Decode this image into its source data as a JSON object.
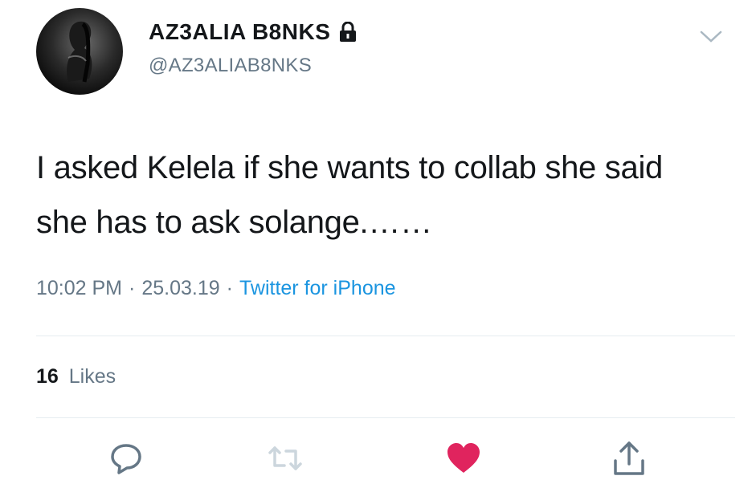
{
  "user": {
    "display_name": "AZ3ALIA B8NKS",
    "handle": "@AZ3ALIAB8NKS"
  },
  "tweet": {
    "text_line1": "I asked Kelela if she wants to collab she said",
    "text_line2": "she has to ask solange.……",
    "time": "10:02 PM",
    "date": "25.03.19",
    "separator": "·",
    "source": "Twitter for iPhone"
  },
  "stats": {
    "likes_count": "16",
    "likes_label": "Likes"
  },
  "actions": {
    "icons": [
      "reply-icon",
      "retweet-icon",
      "like-icon",
      "share-icon"
    ],
    "liked": true
  },
  "colors": {
    "text": "#14171a",
    "secondary": "#657786",
    "link": "#1b95e0",
    "like": "#e0245e",
    "divider": "#e6ecf0"
  }
}
